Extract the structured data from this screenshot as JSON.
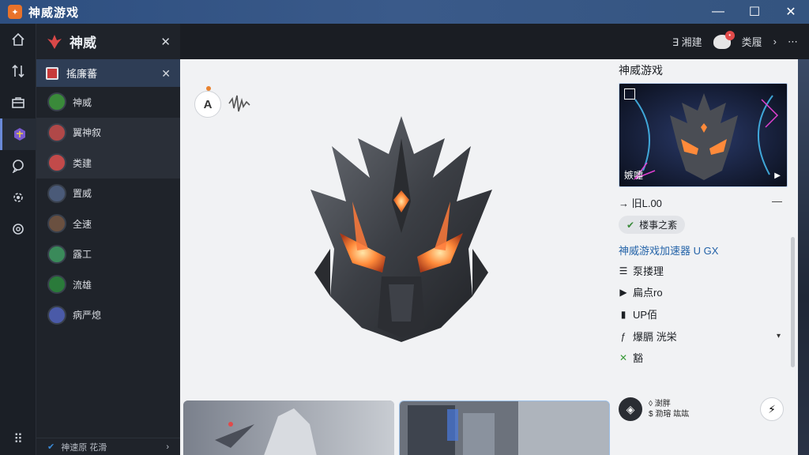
{
  "window": {
    "title": "神威游戏",
    "logo_glyph": "✦",
    "controls": {
      "minimize": "—",
      "maximize": "☐",
      "close": "✕"
    }
  },
  "header": {
    "right_label_1": "∃ 湘建",
    "notif_count": "•",
    "right_label_2": "类履",
    "chevron": "›",
    "more": "⋯"
  },
  "rail": {
    "items": [
      {
        "name": "home-icon",
        "glyph": "⌂"
      },
      {
        "name": "sort-icon",
        "glyph": "↿⇂"
      },
      {
        "name": "briefcase-icon",
        "glyph": "▭"
      },
      {
        "name": "game-icon",
        "glyph": "◈"
      },
      {
        "name": "chat-icon",
        "glyph": "◌"
      },
      {
        "name": "gear-alt-icon",
        "glyph": "✲"
      },
      {
        "name": "settings-icon",
        "glyph": "⚙"
      }
    ],
    "grid_glyph": "⠿"
  },
  "panel": {
    "title": "神威",
    "close": "✕",
    "sub_title": "搖廉蕃",
    "sub_close": "✕",
    "items": [
      {
        "label": "神威",
        "color": "#3a8a3a"
      },
      {
        "label": "翼神叙",
        "color": "#b04848"
      },
      {
        "label": "类建",
        "color": "#c24a4a"
      },
      {
        "label": "置威",
        "color": "#4a5a78"
      },
      {
        "label": "全速",
        "color": "#6a5040"
      },
      {
        "label": "露工",
        "color": "#3a8a5a"
      },
      {
        "label": "流雄",
        "color": "#2a7a3a"
      },
      {
        "label": "病严熄",
        "color": "#4a5aa8"
      }
    ],
    "footer_label": "神速原 花滑",
    "footer_chev": "›"
  },
  "main": {
    "badge_glyph": "A"
  },
  "right": {
    "title": "神威游戏",
    "hero_caption": "嫉嚏",
    "hero_play": "▶",
    "price_row": "→ 旧L.00",
    "minus": "—",
    "tag_label": "楼事之紊",
    "tag_icon": "✔",
    "link": "神威游戏加速器 U GX",
    "rows": [
      {
        "icon": "☰",
        "label": "泵搂理"
      },
      {
        "icon": "▶",
        "label": "扁点ro"
      },
      {
        "icon": "▮",
        "label": "UP佰"
      },
      {
        "icon": "ƒ",
        "label": "爆膈 洸栄"
      },
      {
        "icon": "✕",
        "label": "豁"
      }
    ],
    "dropdown_chev": "▾",
    "footer_line1": "◊ 澍胖",
    "footer_line2": "$ 泐瑢 竑竑",
    "footer_avatar_glyph": "◈",
    "bolt_glyph": "⚡"
  },
  "colors": {
    "titlebar": "#34547f",
    "sidebar_highlight": "#2e3d55",
    "link": "#2463a8",
    "accent_orange": "#f08a2a"
  }
}
